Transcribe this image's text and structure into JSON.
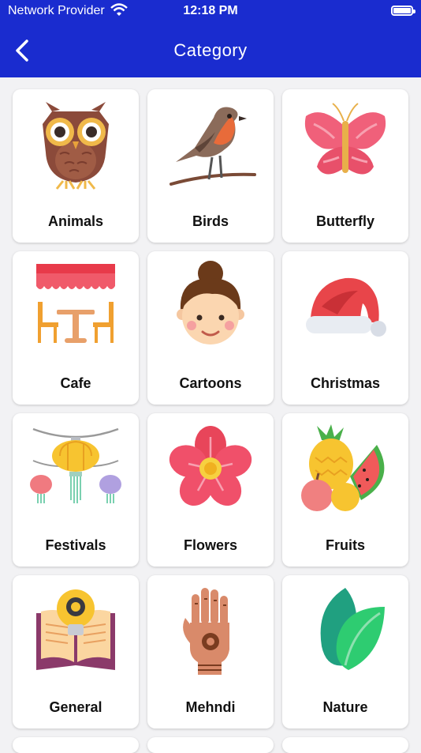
{
  "status_bar": {
    "carrier": "Network Provider",
    "time": "12:18 PM"
  },
  "nav": {
    "title": "Category",
    "back_icon": "chevron-left-icon"
  },
  "colors": {
    "header": "#1a2ccf",
    "background": "#f2f2f4"
  },
  "categories": [
    {
      "label": "Animals",
      "icon": "owl-icon"
    },
    {
      "label": "Birds",
      "icon": "robin-icon"
    },
    {
      "label": "Butterfly",
      "icon": "butterfly-icon"
    },
    {
      "label": "Cafe",
      "icon": "cafe-table-icon"
    },
    {
      "label": "Cartoons",
      "icon": "cartoon-girl-icon"
    },
    {
      "label": "Christmas",
      "icon": "santa-hat-icon"
    },
    {
      "label": "Festivals",
      "icon": "lanterns-icon"
    },
    {
      "label": "Flowers",
      "icon": "flower-icon"
    },
    {
      "label": "Fruits",
      "icon": "fruits-icon"
    },
    {
      "label": "General",
      "icon": "idea-book-icon"
    },
    {
      "label": "Mehndi",
      "icon": "henna-hand-icon"
    },
    {
      "label": "Nature",
      "icon": "leaves-icon"
    }
  ]
}
